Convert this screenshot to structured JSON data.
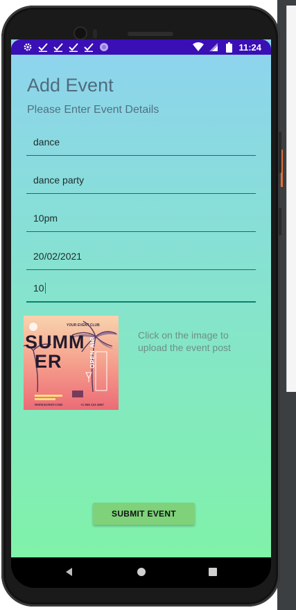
{
  "statusbar": {
    "time": "11:24",
    "left_icons": [
      "gear-icon",
      "check-icon",
      "check-icon",
      "check-icon",
      "check-icon",
      "circle-icon"
    ],
    "right_icons": [
      "wifi-icon",
      "signal-icon",
      "battery-icon"
    ],
    "color": "#3a0fb5"
  },
  "form": {
    "title": "Add Event",
    "subtitle": "Please Enter Event Details",
    "fields": [
      {
        "value": "dance"
      },
      {
        "value": "dance party"
      },
      {
        "value": "10pm"
      },
      {
        "value": "20/02/2021"
      },
      {
        "value": "10"
      }
    ],
    "upload_hint": "Click on the image to upload the event post",
    "submit_label": "SUBMIT EVENT"
  },
  "poster": {
    "brand": "YOUR EVENT CLUB",
    "title_line1": "SUMM",
    "title_line2": "ER",
    "side_text": "OPEN AIR",
    "website": "WWW.EVENT.COM",
    "phone": "+1 555 123 4567"
  },
  "navbar": {
    "icons": [
      "back-icon",
      "home-icon",
      "recents-icon"
    ]
  },
  "colors": {
    "gradient_top": "#8ed3ef",
    "gradient_bottom": "#80f2a9",
    "submit_bg": "#7fd27a"
  }
}
